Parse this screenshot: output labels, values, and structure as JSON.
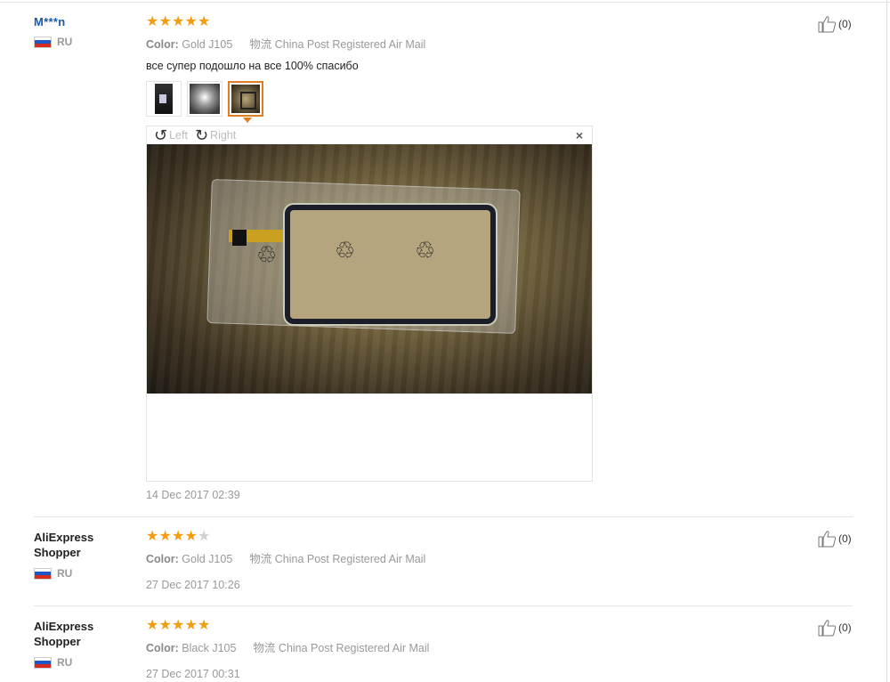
{
  "reviews": [
    {
      "user": "M***n",
      "country": "RU",
      "rating": 5,
      "color_label": "Color:",
      "color_value": "Gold J105",
      "shipping_label": "物流",
      "shipping_value": "China Post Registered Air Mail",
      "comment": "все супер подошло на все 100% спасибо",
      "thumbnails": 3,
      "selected_thumbnail": 3,
      "viewer": {
        "left_label": "Left",
        "right_label": "Right",
        "close": "×"
      },
      "date": "14 Dec 2017 02:39",
      "likes": "(0)"
    },
    {
      "user": "AliExpress Shopper",
      "country": "RU",
      "rating": 4,
      "color_label": "Color:",
      "color_value": "Gold J105",
      "shipping_label": "物流",
      "shipping_value": "China Post Registered Air Mail",
      "date": "27 Dec 2017 10:26",
      "likes": "(0)"
    },
    {
      "user": "AliExpress Shopper",
      "country": "RU",
      "rating": 5,
      "color_label": "Color:",
      "color_value": "Black J105",
      "shipping_label": "物流",
      "shipping_value": "China Post Registered Air Mail",
      "date": "27 Dec 2017 00:31",
      "likes": "(0)"
    }
  ],
  "icons": {
    "star": "star-icon",
    "thumbs_up": "thumbs-up-icon",
    "rotate_left": "rotate-left-icon",
    "rotate_right": "rotate-right-icon",
    "close": "close-icon",
    "flag": "russia-flag-icon"
  },
  "colors": {
    "star_on": "#f39c12",
    "star_off": "#d0d0d0",
    "username_link": "#1a5aa6",
    "selected_thumb": "#e07d22"
  }
}
